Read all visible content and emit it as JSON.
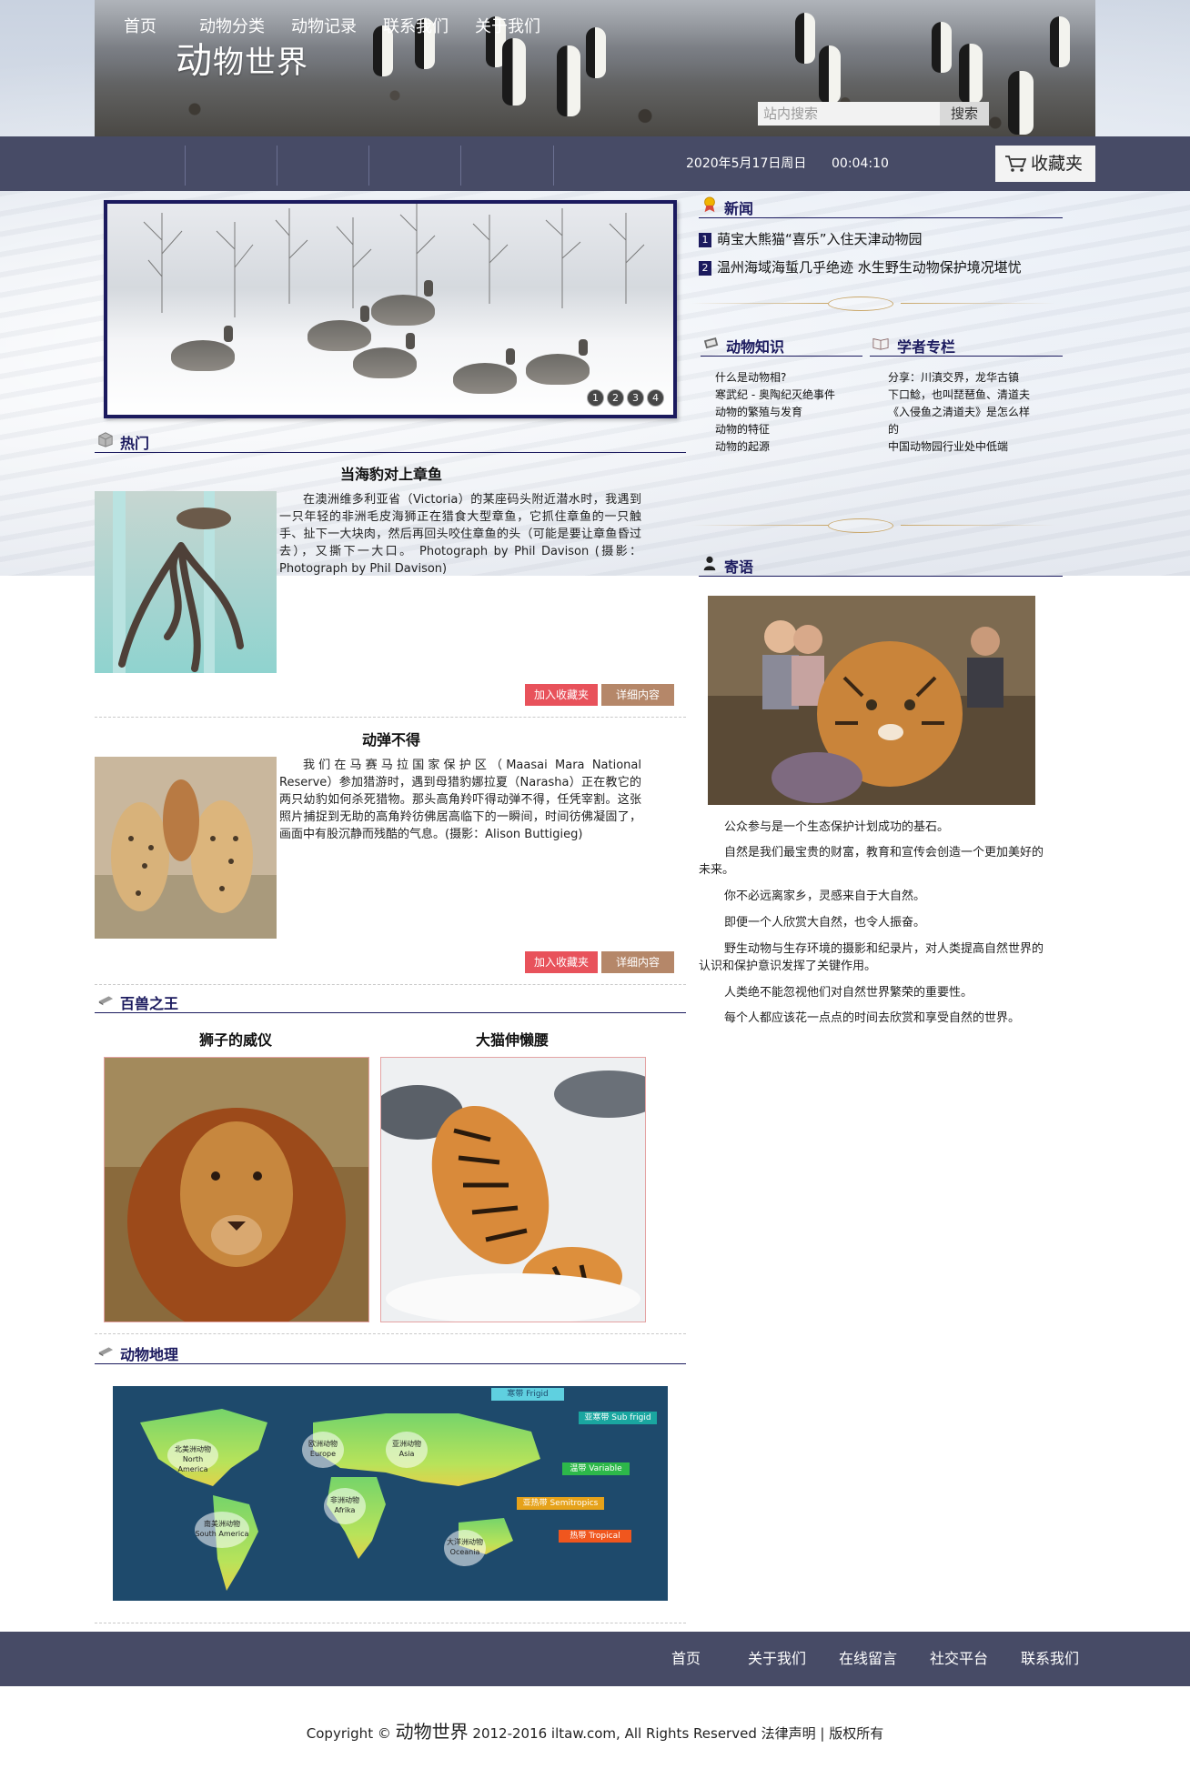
{
  "site": {
    "logo_big": "动",
    "logo_rest": "物世界"
  },
  "search": {
    "placeholder": "站内搜索",
    "button": "搜索"
  },
  "nav": {
    "items": [
      "首页",
      "动物分类",
      "动物记录",
      "联系我们",
      "关于我们"
    ],
    "date": "2020年5月17日周日",
    "time": "00:04:10",
    "favorites": "收藏夹"
  },
  "slider": {
    "dots": [
      "1",
      "2",
      "3",
      "4"
    ]
  },
  "news": {
    "title": "新闻",
    "items": [
      {
        "num": "1",
        "text": "萌宝大熊猫“喜乐”入住天津动物园"
      },
      {
        "num": "2",
        "text": "温州海域海蜇几乎绝迹 水生野生动物保护境况堪忧"
      }
    ]
  },
  "knowledge": {
    "title": "动物知识",
    "items": [
      "什么是动物相?",
      "寒武纪 - 奥陶纪灭绝事件",
      "动物的繁殖与发育",
      "动物的特征",
      "动物的起源"
    ]
  },
  "column": {
    "title": "学者专栏",
    "items": [
      "分享：川滇交界，龙华古镇",
      "下口鲶，也叫琵琶鱼、清道夫",
      "《入侵鱼之清道夫》是怎么样的",
      "中国动物园行业处中低端"
    ]
  },
  "hot": {
    "title": "热门",
    "articles": [
      {
        "title": "当海豹对上章鱼",
        "text": "在澳洲维多利亚省（Victoria）的某座码头附近潜水时，我遇到一只年轻的非洲毛皮海狮正在猎食大型章鱼，它抓住章鱼的一只触手、扯下一大块肉，然后再回头咬住章鱼的头（可能是要让章鱼昏过去），又撕下一大口。 Photograph by Phil Davison (摄影：Photograph by Phil Davison)",
        "fav": "加入收藏夹",
        "detail": "详细内容"
      },
      {
        "title": "动弹不得",
        "text": "我们在马赛马拉国家保护区（Maasai Mara National Reserve）参加猎游时，遇到母猎豹娜拉夏（Narasha）正在教它的 两只幼豹如何杀死猎物。那头高角羚吓得动弹不得，任凭宰割。这张照片捕捉到无助的高角羚彷佛居高临下的一瞬间，时间彷佛凝固了，画面中有股沉静而残酷的气息。(摄影：Alison Buttigieg)",
        "fav": "加入收藏夹",
        "detail": "详细内容"
      }
    ]
  },
  "message": {
    "title": "寄语",
    "paragraphs": [
      "公众参与是一个生态保护计划成功的基石。",
      "自然是我们最宝贵的财富，教育和宣传会创造一个更加美好的未来。",
      "你不必远离家乡，灵感来自于大自然。",
      "即便一个人欣赏大自然，也令人振奋。",
      "野生动物与生存环境的摄影和纪录片，对人类提高自然世界的认识和保护意识发挥了关键作用。",
      "人类绝不能忽视他们对自然世界繁荣的重要性。",
      "每个人都应该花一点点的时间去欣赏和享受自然的世界。"
    ]
  },
  "kings": {
    "title": "百兽之王",
    "captions": [
      "狮子的威仪",
      "大猫伸懒腰"
    ]
  },
  "geo": {
    "title": "动物地理",
    "zones": [
      "寒带 Frigid",
      "亚寒带 Sub frigid",
      "温带 Variable",
      "亚热带 Semitropics",
      "热带 Tropical"
    ],
    "regions": [
      {
        "cn": "北美洲动物",
        "en": "North America"
      },
      {
        "cn": "欧洲动物",
        "en": "Europe"
      },
      {
        "cn": "亚洲动物",
        "en": "Asia"
      },
      {
        "cn": "非洲动物",
        "en": "Afrika"
      },
      {
        "cn": "南美洲动物",
        "en": "South America"
      },
      {
        "cn": "大洋洲动物",
        "en": "Oceania"
      }
    ]
  },
  "footer": {
    "links": [
      "首页",
      "关于我们",
      "在线留言",
      "社交平台",
      "联系我们"
    ],
    "copyright_pre": "Copyright ©",
    "copyright_brand": "动物世界",
    "copyright_post": "2012-2016 iltaw.com, All Rights Reserved 法律声明 | 版权所有"
  },
  "colors": {
    "nav_bg": "#474b66",
    "accent_navy": "#1b1a5e",
    "fav_red": "#e8525b",
    "detail_brown": "#b58769"
  }
}
